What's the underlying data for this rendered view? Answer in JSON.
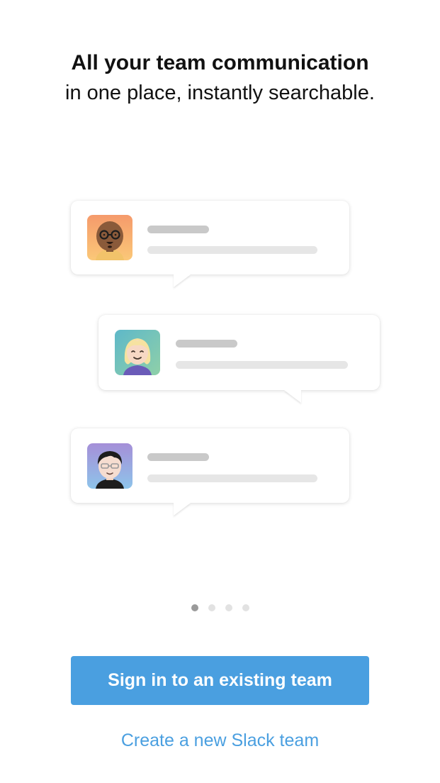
{
  "onboarding": {
    "title": "All your team communication",
    "subtitle": "in one place, instantly searchable."
  },
  "illustration": {
    "messages": [
      {
        "avatar": "avatar-bald-glasses-man-icon"
      },
      {
        "avatar": "avatar-blonde-woman-icon"
      },
      {
        "avatar": "avatar-glasses-man-icon"
      }
    ]
  },
  "pagination": {
    "total": 4,
    "active": 1
  },
  "actions": {
    "sign_in_label": "Sign in to an existing team",
    "create_label": "Create a new Slack team"
  },
  "colors": {
    "accent": "#4a9fe0"
  }
}
